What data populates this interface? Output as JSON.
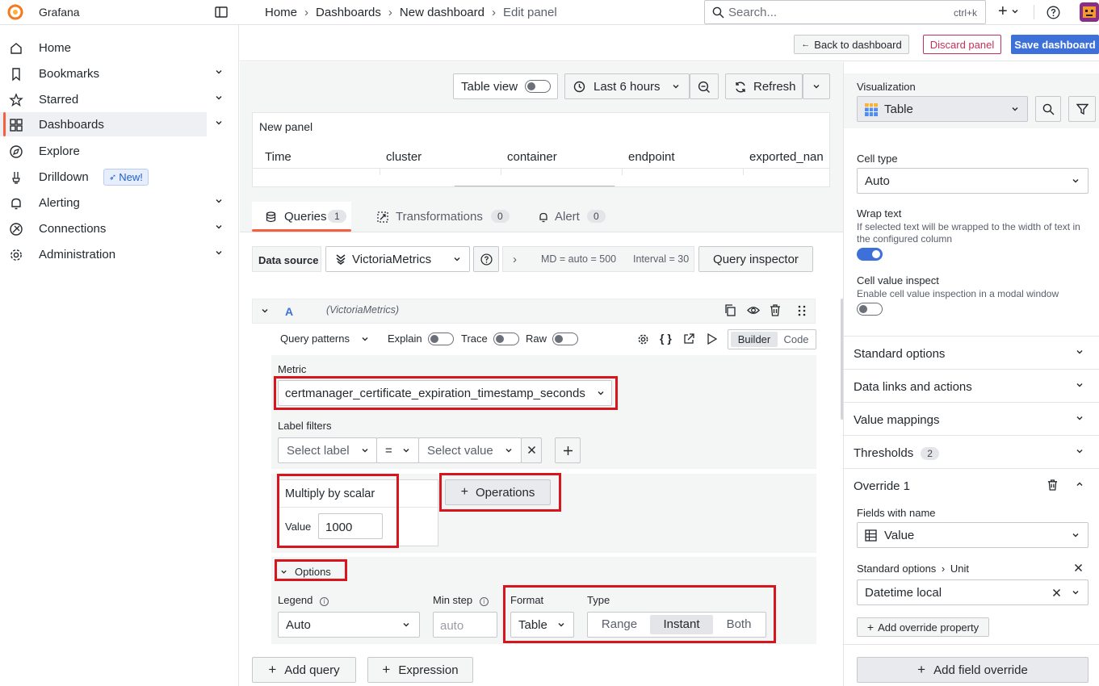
{
  "app": {
    "name": "Grafana"
  },
  "breadcrumb": [
    "Home",
    "Dashboards",
    "New dashboard",
    "Edit panel"
  ],
  "search": {
    "placeholder": "Search...",
    "shortcut": "ctrl+k"
  },
  "topbar": {
    "new_label": "+"
  },
  "actions": {
    "back": "Back to dashboard",
    "discard": "Discard panel",
    "save": "Save dashboard"
  },
  "nav": [
    {
      "label": "Home",
      "icon": "home-icon"
    },
    {
      "label": "Bookmarks",
      "icon": "bookmark-icon"
    },
    {
      "label": "Starred",
      "icon": "star-icon"
    },
    {
      "label": "Dashboards",
      "icon": "dashboards-icon"
    },
    {
      "label": "Explore",
      "icon": "compass-icon"
    },
    {
      "label": "Drilldown",
      "icon": "drilldown-icon",
      "badge": "New!"
    },
    {
      "label": "Alerting",
      "icon": "bell-icon"
    },
    {
      "label": "Connections",
      "icon": "connections-icon"
    },
    {
      "label": "Administration",
      "icon": "gear-icon"
    }
  ],
  "panel_toolbar": {
    "table_view": "Table view",
    "time_range": "Last 6 hours",
    "refresh": "Refresh"
  },
  "panel": {
    "title": "New panel",
    "columns": [
      "Time",
      "cluster",
      "container",
      "endpoint",
      "exported_nan"
    ]
  },
  "tabs": [
    {
      "label": "Queries",
      "count": "1"
    },
    {
      "label": "Transformations",
      "count": "0"
    },
    {
      "label": "Alert",
      "count": "0"
    }
  ],
  "datasource": {
    "label": "Data source",
    "value": "VictoriaMetrics",
    "md": "MD = auto = 500",
    "interval": "Interval = 30",
    "inspector": "Query inspector"
  },
  "query": {
    "ref": "A",
    "source": "(VictoriaMetrics)",
    "patterns": "Query patterns",
    "explain": "Explain",
    "trace": "Trace",
    "raw": "Raw",
    "builder": "Builder",
    "code": "Code",
    "metric_label": "Metric",
    "metric": "certmanager_certificate_expiration_timestamp_seconds",
    "label_filters": "Label filters",
    "select_label": "Select label",
    "op": "=",
    "select_value": "Select value",
    "operation": {
      "name": "Multiply by scalar",
      "value_label": "Value",
      "value": "1000"
    },
    "operations_btn": "Operations",
    "options": "Options",
    "legend_label": "Legend",
    "legend": "Auto",
    "minstep_label": "Min step",
    "minstep_placeholder": "auto",
    "format_label": "Format",
    "format": "Table",
    "type_label": "Type",
    "types": [
      "Range",
      "Instant",
      "Both"
    ],
    "type_selected": "Instant"
  },
  "bottom": {
    "add_query": "Add query",
    "expression": "Expression"
  },
  "right": {
    "viz_label": "Visualization",
    "viz": "Table",
    "cell_type_label": "Cell type",
    "cell_type": "Auto",
    "wrap_label": "Wrap text",
    "wrap_desc": "If selected text will be wrapped to the width of text in the configured column",
    "inspect_label": "Cell value inspect",
    "inspect_desc": "Enable cell value inspection in a modal window",
    "sections": [
      "Standard options",
      "Data links and actions",
      "Value mappings",
      "Thresholds"
    ],
    "thresholds_count": "2",
    "override_title": "Override 1",
    "fields_label": "Fields with name",
    "fields_value": "Value",
    "unit_path": "Standard options",
    "unit_label": "Unit",
    "unit_value": "Datetime local",
    "add_prop": "Add override property",
    "add_override": "Add field override"
  }
}
